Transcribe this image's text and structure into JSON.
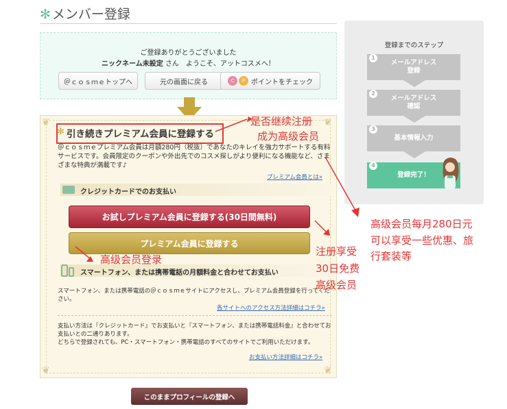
{
  "header": {
    "title": "メンバー登録",
    "star": "✻"
  },
  "welcome": {
    "line1": "ご登録ありがとうございました",
    "nickname": "ニックネーム未設定",
    "line2_rest": "さん　ようこそ、アットコスメへ！",
    "buttons": {
      "top": "＠ｃｏｓｍｅトップへ",
      "back": "元の画面に戻る",
      "points": "ポイントをチェック"
    },
    "badge_c": "C",
    "badge_p": "P"
  },
  "premium": {
    "star": "✻",
    "heading": "引き続きプレミアム会員に登録する",
    "description": "＠ｃｏｓｍｅプレミアム会員は月額280円（税抜）であなたのキレイを強力サポートする有料サービスです。会員限定のクーポンや外出先でのコスメ探しがより便利になる機能など、さまざまな特典が満載です♪",
    "about_link": "プレミアム会員とは»",
    "credit_label": "クレジットカードでのお支払い",
    "trial_button": "お試しプレミアム会員に登録する(30日間無料)",
    "register_button": "プレミアム会員に登録する",
    "phone_label": "スマートフォン、または携帯電話の月額料金と合わせてお支払い",
    "phone_desc": "スマートフォン、または携帯電話の＠ｃｏｓｍｅサイトにアクセスし、プレミアム会員登録を行ってください。",
    "access_link": "各サイトへのアクセス方法詳細はコチラ»",
    "pay_desc1": "支払い方法は『クレジットカード』でお支払いと『スマートフォン、または携帯電話料金』と合わせてお支払いとの二通りあります。",
    "pay_desc2": "どちらで登録されても、PC・スマートフォン・携帯電話のすべてのサイトでご利用いただけます。",
    "payment_link": "お支払い方法詳細はコチラ»"
  },
  "profile_button": "このままプロフィールの登録へ",
  "steps": {
    "title": "登録までのステップ",
    "items": [
      {
        "num": "1",
        "line1": "メールアドレス",
        "line2": "登録"
      },
      {
        "num": "2",
        "line1": "メールアドレス",
        "line2": "確認"
      },
      {
        "num": "3",
        "line1": "基本情報入力",
        "line2": ""
      },
      {
        "num": "4",
        "line1": "登録完了！",
        "line2": ""
      }
    ]
  },
  "annotations": {
    "continue_line1": "是否继续注册",
    "continue_line2": "成为高级会员",
    "monthly_line1": "高级会员每月280日元",
    "monthly_line2": "可以享受一些优惠、旅",
    "monthly_line3": "行套装等",
    "trial_line1": "注册享受",
    "trial_line2": "30日免费",
    "trial_line3": "高级会员",
    "login": "高级会员登录"
  },
  "colors": {
    "accent_green": "#5ec49c",
    "trial_red": "#a52535",
    "register_gold": "#b89a3a",
    "annotation_red": "#e23636",
    "profile_brown": "#5e2f2f"
  }
}
